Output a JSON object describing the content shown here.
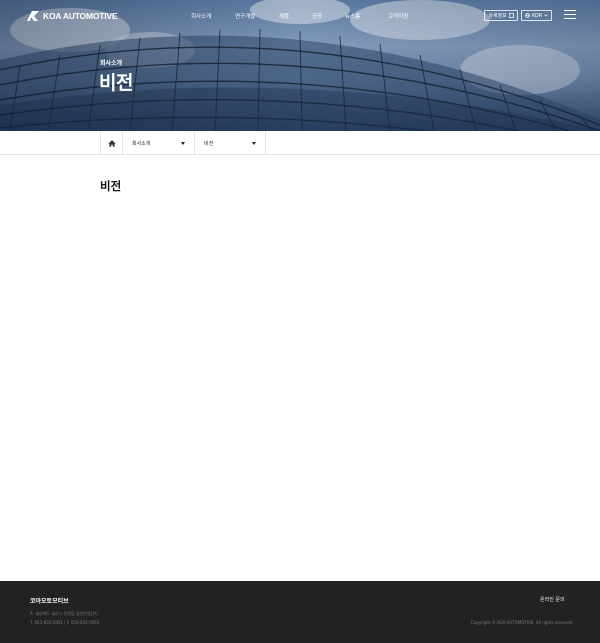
{
  "header": {
    "logo_text": "KOA AUTOMOTIVE",
    "nav": [
      "회사소개",
      "연구개발",
      "제품",
      "공장",
      "뉴스룸",
      "고객지원"
    ],
    "sitemap_label": "상세정보",
    "lang_label": "KOR"
  },
  "hero": {
    "subtitle": "회사소개",
    "title": "비전"
  },
  "breadcrumb": {
    "depth1": "회사소개",
    "depth2": "비전"
  },
  "content": {
    "title": "비전"
  },
  "footer": {
    "company": "코아오토모티브",
    "address": "A. 경상북도 경산시 진량읍 일반산업단지",
    "tel": "T. 053-855-5951   |   F. 053-855-5955",
    "link": "온라인 문의",
    "copyright": "Copyright © KOA AUTOMOTIVE. All rights reserved."
  },
  "colors": {
    "footer_bg": "#222222",
    "border": "#e2e2e2"
  }
}
